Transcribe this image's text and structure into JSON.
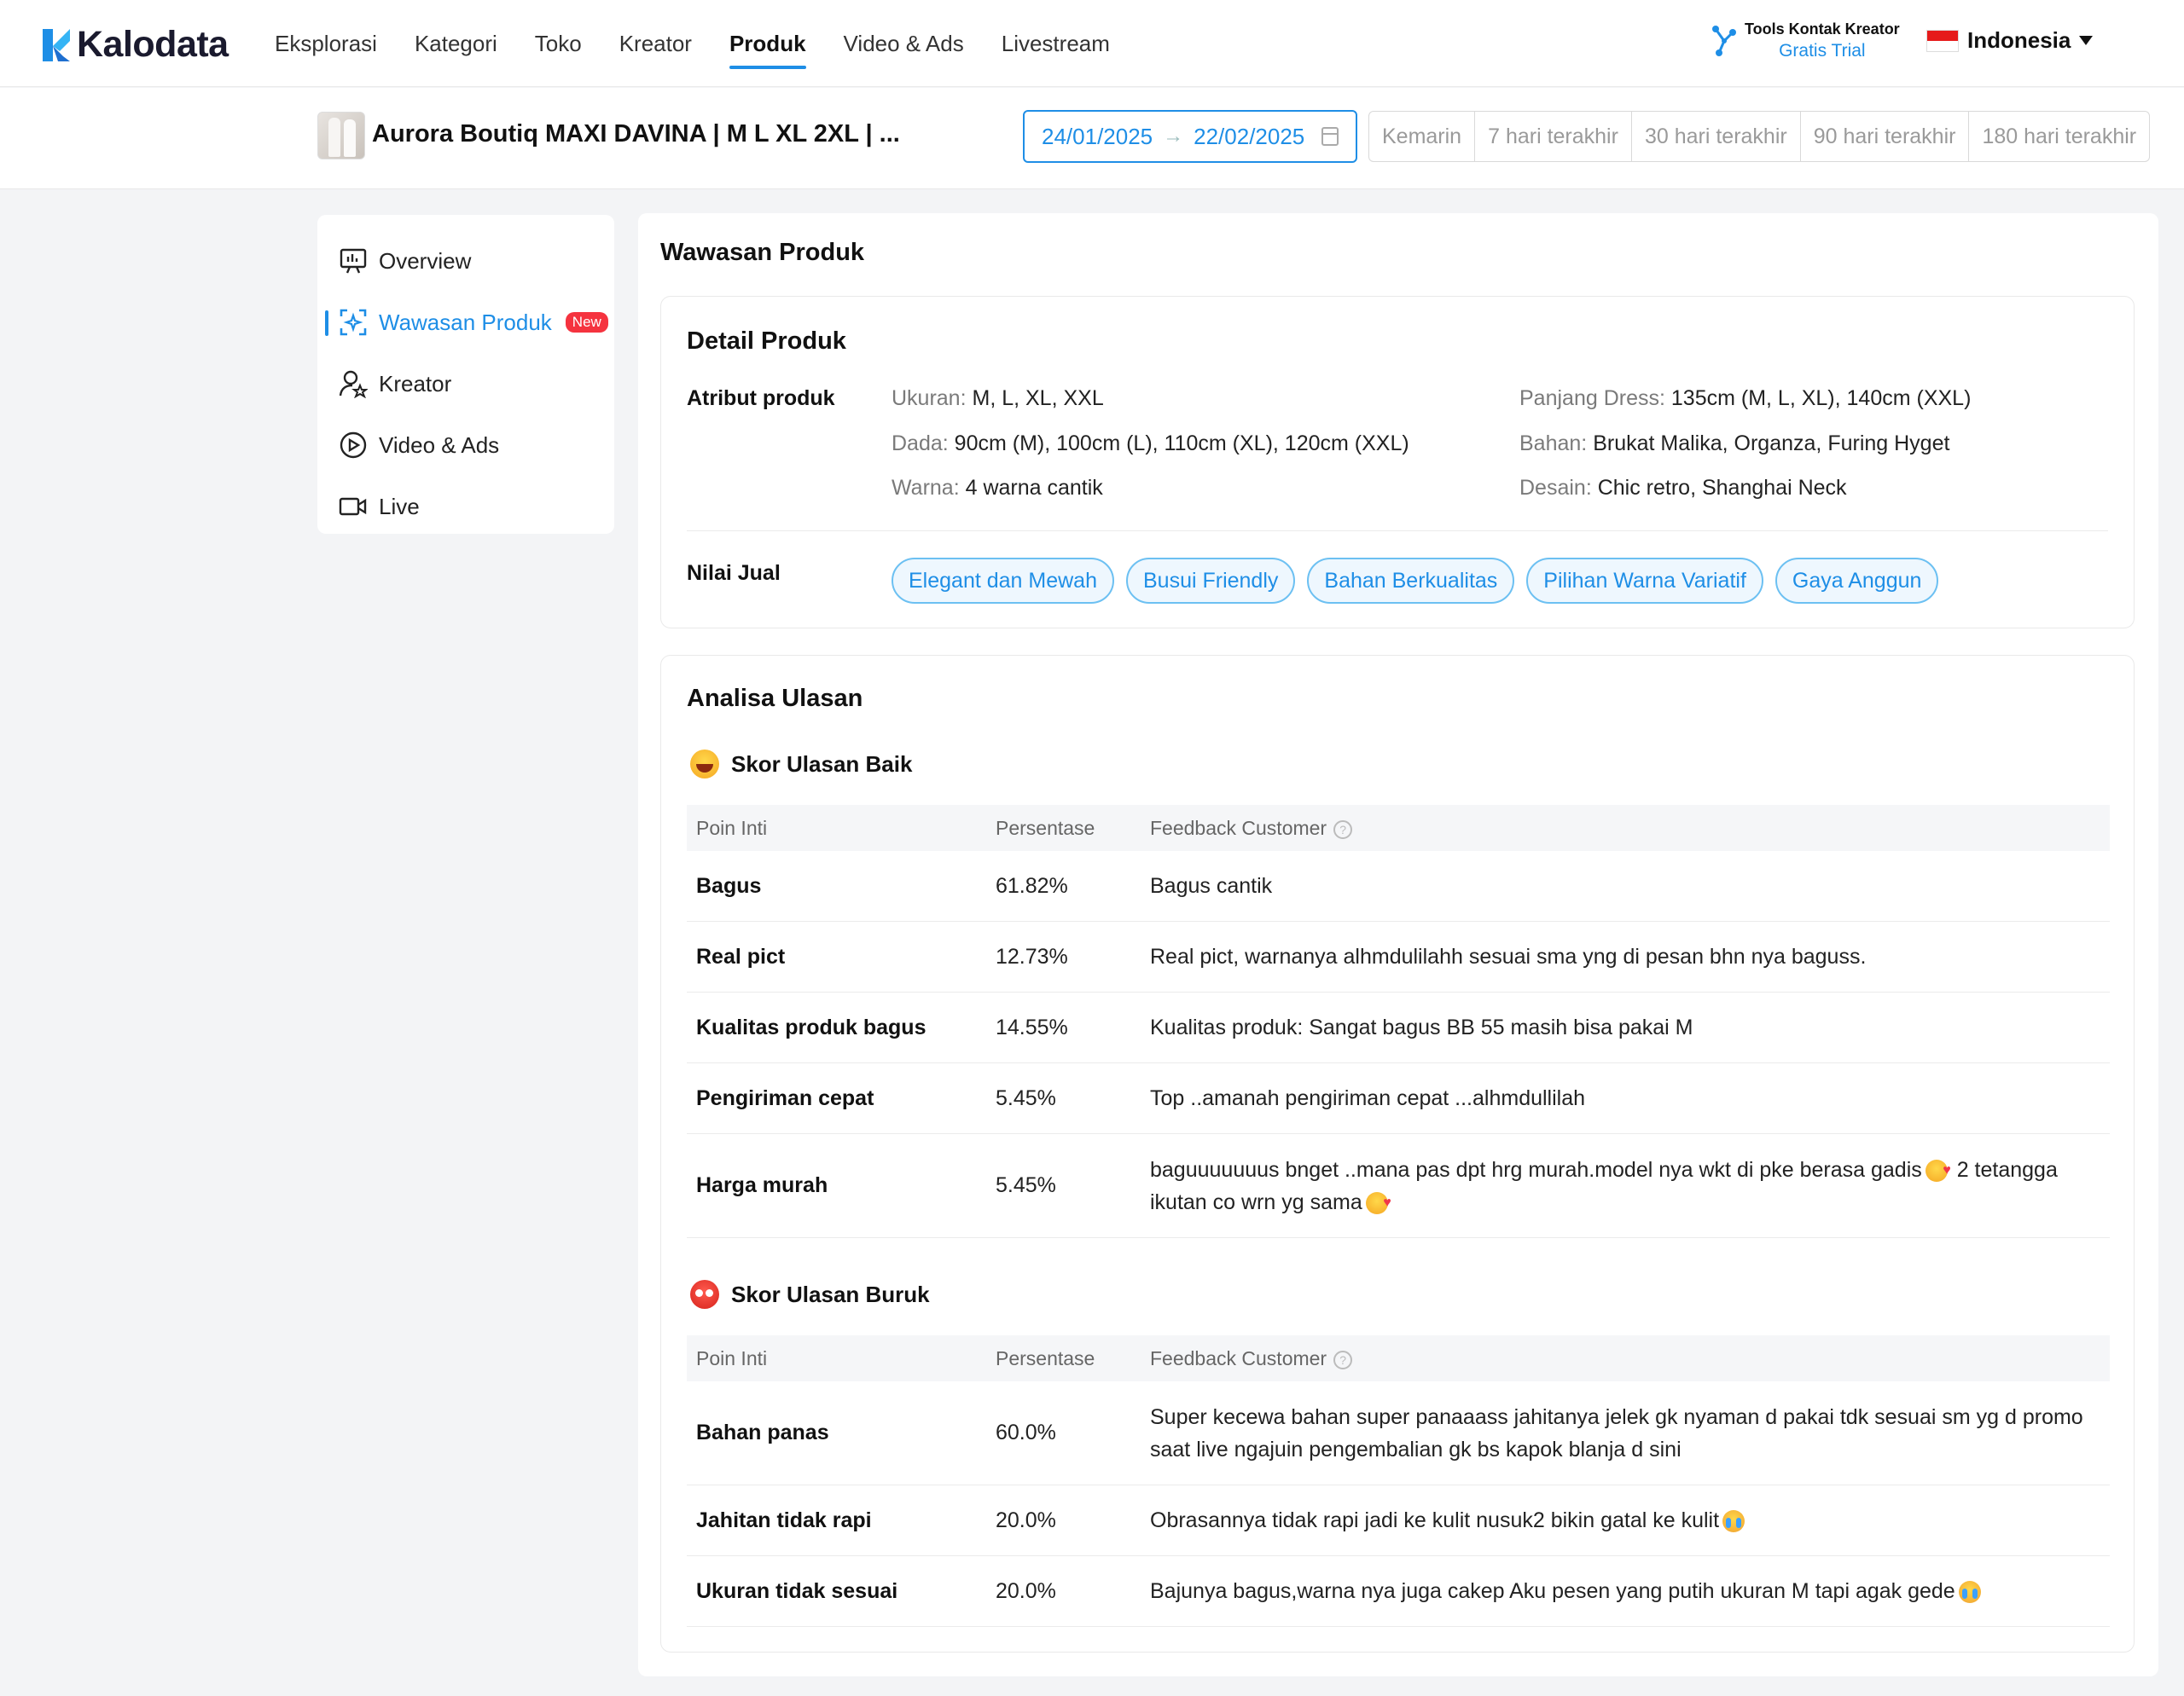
{
  "nav": {
    "logo": "Kalodata",
    "items": [
      "Eksplorasi",
      "Kategori",
      "Toko",
      "Kreator",
      "Produk",
      "Video & Ads",
      "Livestream"
    ],
    "active": "Produk",
    "tools_title": "Tools Kontak Kreator",
    "tools_sub": "Gratis Trial",
    "language": "Indonesia"
  },
  "product": {
    "title": "Aurora Boutiq MAXI DAVINA | M L XL 2XL | ..."
  },
  "date": {
    "start": "24/01/2025",
    "end": "22/02/2025",
    "arrow": "→",
    "quick": [
      "Kemarin",
      "7 hari terakhir",
      "30 hari terakhir",
      "90 hari terakhir",
      "180 hari terakhir"
    ]
  },
  "sidebar": {
    "items": [
      {
        "label": "Overview",
        "icon": "presentation-chart-icon"
      },
      {
        "label": "Wawasan Produk",
        "icon": "ai-scan-icon",
        "badge": "New"
      },
      {
        "label": "Kreator",
        "icon": "user-star-icon"
      },
      {
        "label": "Video & Ads",
        "icon": "play-circle-icon"
      },
      {
        "label": "Live",
        "icon": "video-camera-icon"
      }
    ],
    "active": "Wawasan Produk"
  },
  "main": {
    "title": "Wawasan Produk",
    "detail": {
      "title": "Detail Produk",
      "attr_label": "Atribut produk",
      "attrs": [
        {
          "k": "Ukuran:",
          "v": "M, L, XL, XXL"
        },
        {
          "k": "Panjang Dress:",
          "v": "135cm (M, L, XL), 140cm (XXL)"
        },
        {
          "k": "Dada:",
          "v": "90cm (M), 100cm (L), 110cm (XL), 120cm (XXL)"
        },
        {
          "k": "Bahan:",
          "v": "Brukat Malika, Organza, Furing Hyget"
        },
        {
          "k": "Warna:",
          "v": "4 warna cantik"
        },
        {
          "k": "Desain:",
          "v": "Chic retro, Shanghai Neck"
        }
      ],
      "nilai_label": "Nilai Jual",
      "tags": [
        "Elegant dan Mewah",
        "Busui Friendly",
        "Bahan Berkualitas",
        "Pilihan Warna Variatif",
        "Gaya Anggun"
      ]
    },
    "analisa": {
      "title": "Analisa Ulasan",
      "headers": {
        "c1": "Poin Inti",
        "c2": "Persentase",
        "c3": "Feedback Customer"
      },
      "good": {
        "title": "Skor Ulasan Baik",
        "rows": [
          {
            "poin": "Bagus",
            "pct": "61.82%",
            "fb": "Bagus cantik"
          },
          {
            "poin": "Real pict",
            "pct": "12.73%",
            "fb": "Real pict, warnanya alhmdulilahh sesuai sma yng di pesan bhn nya baguss."
          },
          {
            "poin": "Kualitas produk bagus",
            "pct": "14.55%",
            "fb": "Kualitas produk: Sangat bagus BB 55 masih bisa pakai M"
          },
          {
            "poin": "Pengiriman cepat",
            "pct": "5.45%",
            "fb": "Top ..amanah pengiriman cepat ...alhmdullilah"
          },
          {
            "poin": "Harga murah",
            "pct": "5.45%",
            "fb_a": "baguuuuuuus bnget ..mana pas dpt hrg murah.model nya wkt di pke berasa gadis",
            "fb_b": " 2 tetangga ikutan co wrn yg sama"
          }
        ]
      },
      "bad": {
        "title": "Skor Ulasan Buruk",
        "rows": [
          {
            "poin": "Bahan panas",
            "pct": "60.0%",
            "fb": "Super kecewa bahan super panaaass jahitanya jelek gk nyaman d pakai tdk sesuai sm yg d promo saat live ngajuin pengembalian gk bs kapok blanja d sini"
          },
          {
            "poin": "Jahitan tidak rapi",
            "pct": "20.0%",
            "fb": "Obrasannya tidak rapi jadi ke kulit nusuk2 bikin gatal ke kulit"
          },
          {
            "poin": "Ukuran tidak sesuai",
            "pct": "20.0%",
            "fb": "Bajunya bagus,warna nya juga cakep Aku pesen yang putih ukuran M tapi agak gede"
          }
        ]
      }
    }
  },
  "colors": {
    "accent": "#1e8ee6",
    "badge": "#f5333f"
  }
}
